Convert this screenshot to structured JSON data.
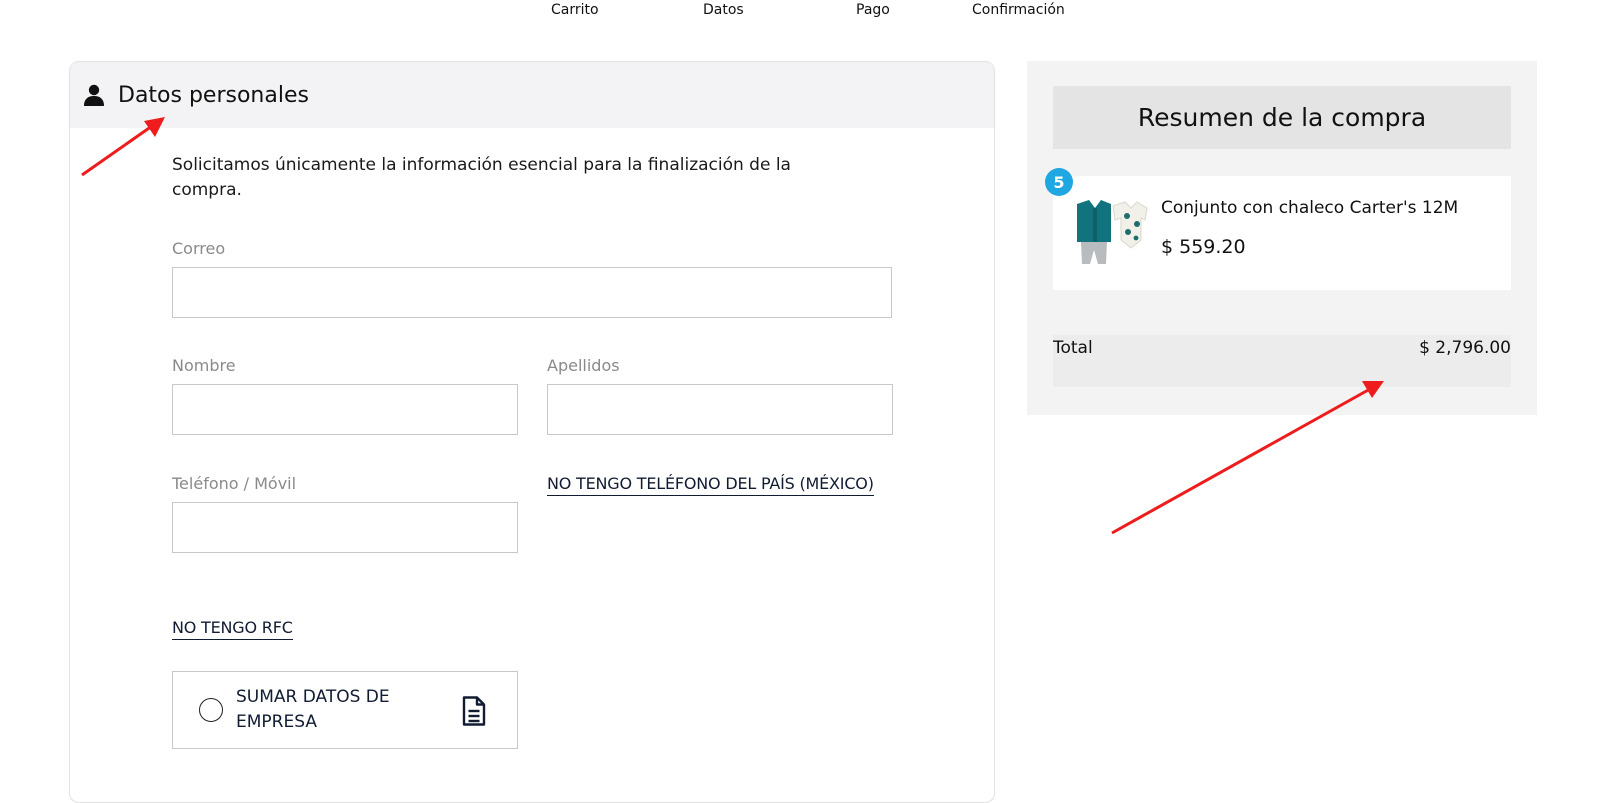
{
  "steps": [
    "Carrito",
    "Datos",
    "Pago",
    "Confirmación"
  ],
  "personal": {
    "title": "Datos personales",
    "intro": "Solicitamos únicamente la información esencial para la finalización de la compra.",
    "email_label": "Correo",
    "first_name_label": "Nombre",
    "last_name_label": "Apellidos",
    "phone_label": "Teléfono / Móvil",
    "no_phone_link": "NO TENGO TELÉFONO DEL PAÍS (MÉXICO)",
    "no_rfc_link": "NO TENGO RFC",
    "company_label": "SUMAR DATOS DE EMPRESA"
  },
  "summary": {
    "title": "Resumen de la compra",
    "item": {
      "quantity": "5",
      "name": "Conjunto con chaleco Carter's 12M",
      "price": "$ 559.20"
    },
    "total_label": "Total",
    "total_value": "$ 2,796.00"
  },
  "colors": {
    "accent_badge": "#1ea7e0",
    "annotation_arrow": "#ee1c1c",
    "link": "#111c33"
  },
  "icons": {
    "user": "user-icon",
    "document": "document-icon"
  }
}
